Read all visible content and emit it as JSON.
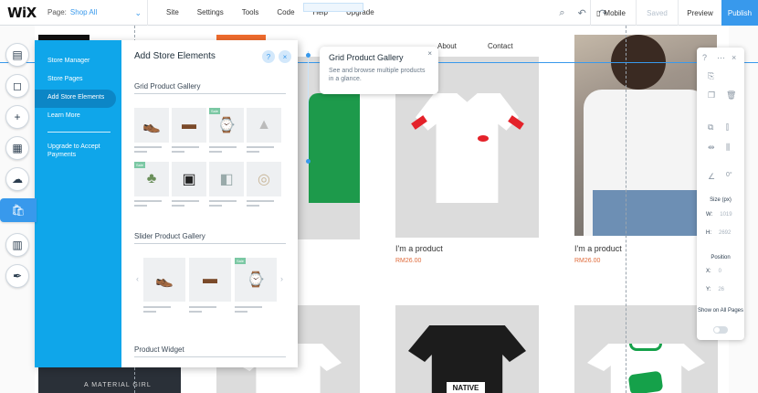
{
  "topbar": {
    "logo": "WiX",
    "page_label": "Page:",
    "page_value": "Shop All",
    "menu": [
      "Site",
      "Settings",
      "Tools",
      "Code",
      "Help",
      "Upgrade"
    ],
    "mobile_label": "Mobile",
    "saved_label": "Saved",
    "preview_label": "Preview",
    "publish_label": "Publish"
  },
  "site": {
    "nav_links": [
      "About",
      "Contact"
    ],
    "products": [
      {
        "name": "I'm a product",
        "price": "RM26.00"
      },
      {
        "name": "I'm a product",
        "price": "RM26.00"
      }
    ],
    "tee_text_1": "NATIVE",
    "banner_text": "A MATERIAL GIRL"
  },
  "panel": {
    "nav": [
      "Store Manager",
      "Store Pages",
      "Add Store Elements",
      "Learn More"
    ],
    "nav_upgrade": "Upgrade to Accept Payments",
    "title": "Add Store Elements",
    "help": "?",
    "close": "×",
    "section_grid": "Grid Product Gallery",
    "section_slider": "Slider Product Gallery",
    "section_widget": "Product Widget",
    "badge_text": "Sale",
    "slider_prev": "‹",
    "slider_next": "›"
  },
  "tooltip": {
    "title": "Grid Product Gallery",
    "description": "See and browse multiple products in a glance.",
    "close": "×"
  },
  "right_toolbar": {
    "help": "?",
    "size_label": "Size (px)",
    "w_label": "W:",
    "w_value": "1019",
    "h_label": "H:",
    "h_value": "2692",
    "position_label": "Position",
    "x_label": "X:",
    "x_value": "0",
    "y_label": "Y:",
    "y_value": "26",
    "rotation_value": "0°",
    "show_all_label": "Show on All Pages"
  }
}
